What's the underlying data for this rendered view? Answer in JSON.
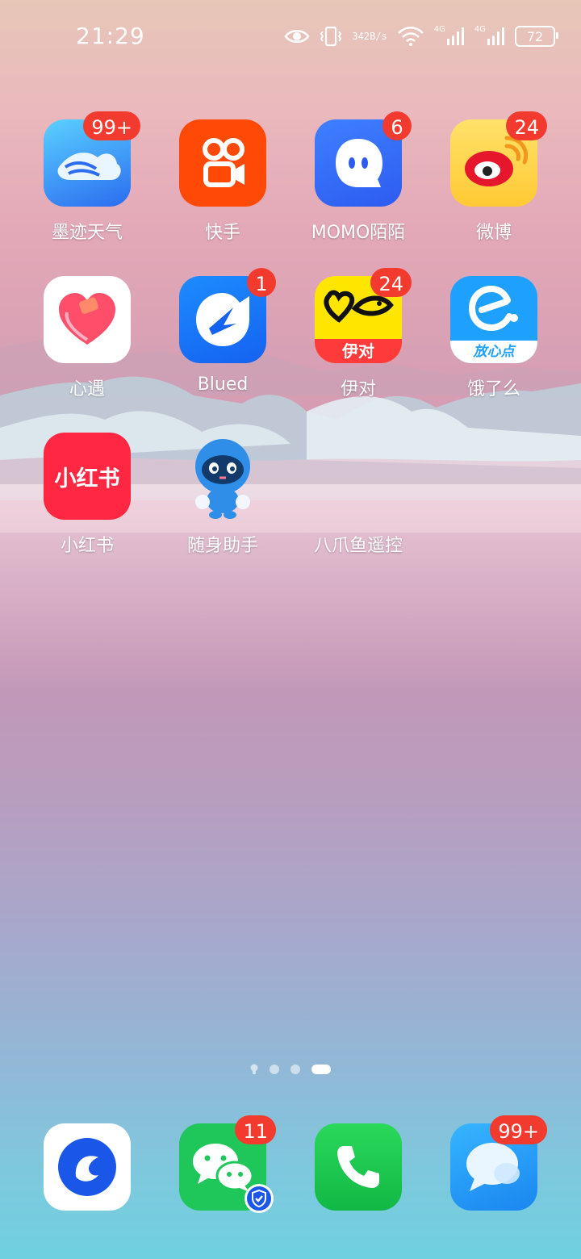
{
  "status_bar": {
    "time": "21:29",
    "net_speed_value": "342",
    "net_speed_unit": "B/s",
    "sim1_label": "4G",
    "sim2_label": "4G",
    "battery": "72"
  },
  "apps": [
    {
      "label": "墨迹天气",
      "badge": "99+",
      "icon": "moji-weather-icon"
    },
    {
      "label": "快手",
      "badge": "",
      "icon": "kuaishou-icon"
    },
    {
      "label": "MOMO陌陌",
      "badge": "6",
      "icon": "momo-icon"
    },
    {
      "label": "微博",
      "badge": "24",
      "icon": "weibo-icon"
    },
    {
      "label": "心遇",
      "badge": "",
      "icon": "xinyu-icon"
    },
    {
      "label": "Blued",
      "badge": "1",
      "icon": "blued-icon"
    },
    {
      "label": "伊对",
      "badge": "24",
      "icon": "yidui-icon",
      "icon_text": "伊对"
    },
    {
      "label": "饿了么",
      "badge": "",
      "icon": "eleme-icon",
      "icon_text": "放心点"
    },
    {
      "label": "小红书",
      "badge": "",
      "icon": "xiaohongshu-icon",
      "icon_text": "小红书"
    },
    {
      "label": "随身助手",
      "badge": "",
      "icon": "assistant-mascot-icon"
    },
    {
      "label": "八爪鱼遥控",
      "badge": "",
      "icon": "octopus-remote-icon"
    }
  ],
  "pages": {
    "count": 3,
    "active": 3
  },
  "dock": [
    {
      "name": "browser",
      "badge": "",
      "icon": "browser-icon"
    },
    {
      "name": "wechat",
      "badge": "11",
      "icon": "wechat-icon"
    },
    {
      "name": "phone",
      "badge": "",
      "icon": "phone-icon"
    },
    {
      "name": "messages",
      "badge": "99+",
      "icon": "messages-icon"
    }
  ],
  "colors": {
    "badge": "#f23a2f",
    "wechat": "#1fc75a",
    "phone": "#18c34a",
    "xiaohongshu": "#ff2741"
  }
}
